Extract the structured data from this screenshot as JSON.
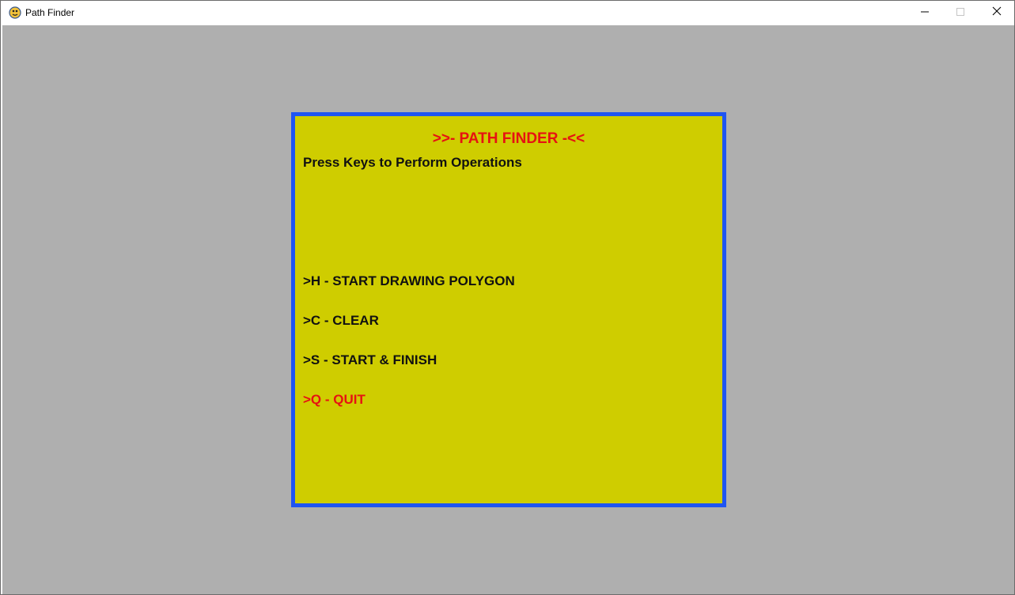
{
  "window": {
    "title": "Path Finder",
    "icon": "pygame-snake-icon",
    "controls": {
      "minimize_icon": "minimize-icon",
      "maximize_icon": "maximize-icon",
      "close_icon": "close-icon"
    }
  },
  "canvas": {
    "background_color": "#afafaf"
  },
  "menu": {
    "background_color": "#cfcd00",
    "border_color": "#1f55f2",
    "title": ">>- PATH FINDER -<<",
    "title_color": "#e61212",
    "subtitle": "Press Keys to Perform Operations",
    "options": [
      {
        "label": ">H - START DRAWING POLYGON",
        "color": "#111111"
      },
      {
        "label": ">C - CLEAR",
        "color": "#111111"
      },
      {
        "label": ">S - START & FINISH",
        "color": "#111111"
      },
      {
        "label": ">Q - QUIT",
        "color": "#e61212"
      }
    ]
  }
}
